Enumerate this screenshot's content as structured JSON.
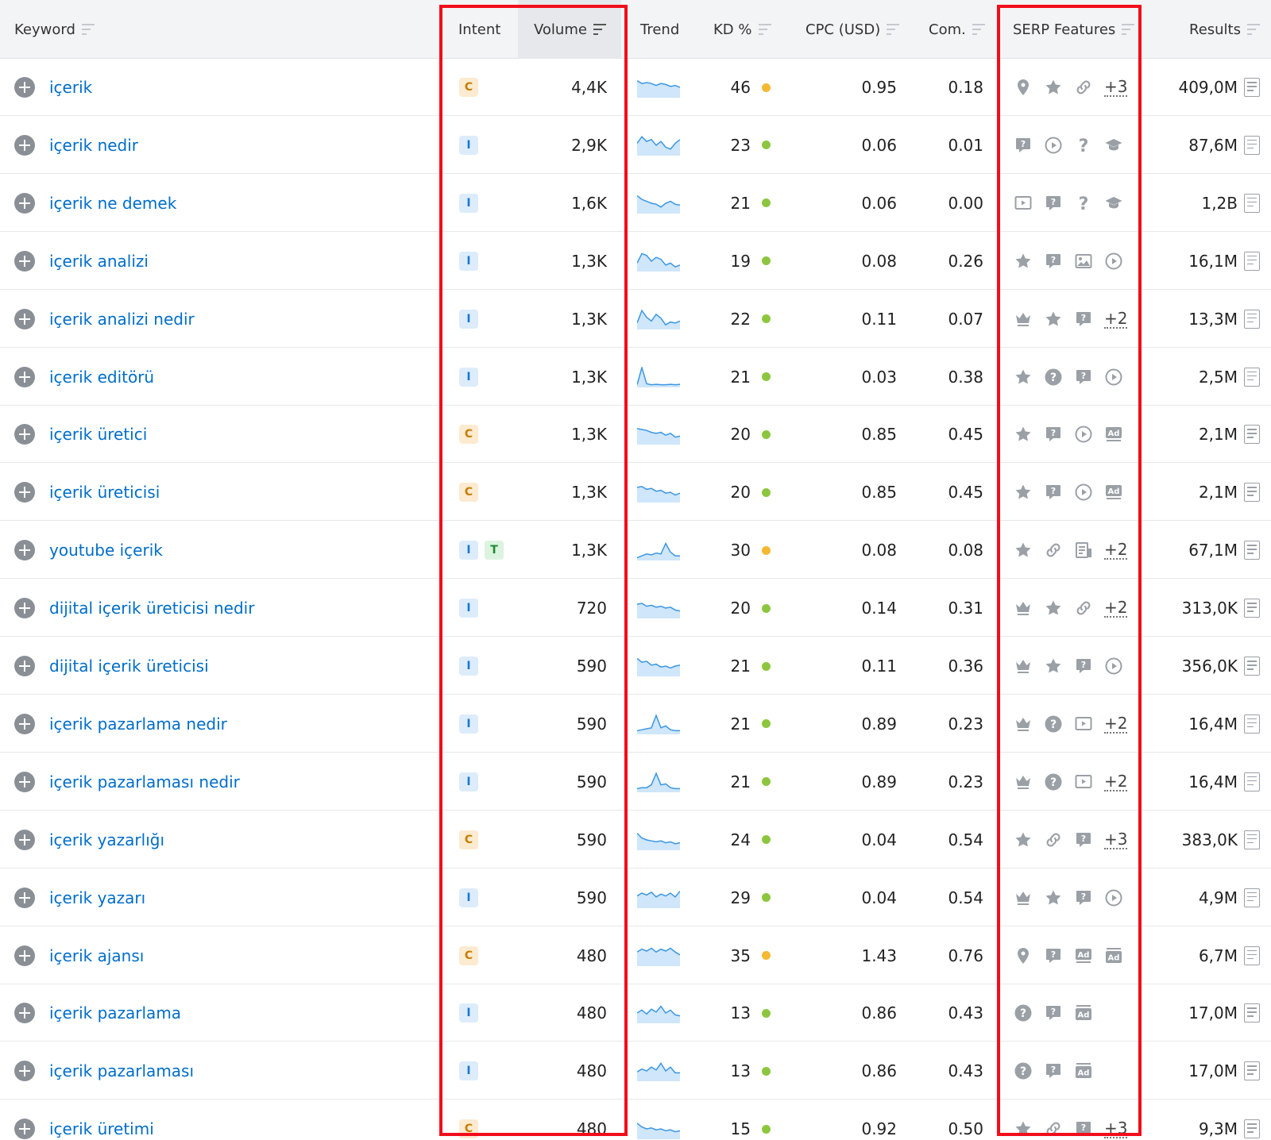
{
  "header": {
    "keyword": "Keyword",
    "intent": "Intent",
    "volume": "Volume",
    "trend": "Trend",
    "kd": "KD %",
    "cpc": "CPC (USD)",
    "com": "Com.",
    "serp": "SERP Features",
    "results": "Results"
  },
  "colors": {
    "kd_green": "#8cc63f",
    "kd_yellow": "#f5b833",
    "highlight_box": "#f20d1b",
    "keyword_link": "#006dca"
  },
  "rows": [
    {
      "keyword": "içerik",
      "intent": [
        "C"
      ],
      "volume": "4,4K",
      "trend": [
        0.85,
        0.7,
        0.75,
        0.7,
        0.6,
        0.7,
        0.65,
        0.55,
        0.6,
        0.5
      ],
      "kd": "46",
      "kd_color": "#f5b833",
      "cpc": "0.95",
      "com": "0.18",
      "serp": [
        "location-icon",
        "star-icon",
        "link-icon"
      ],
      "serp_more": "+3",
      "results": "409,0M"
    },
    {
      "keyword": "içerik nedir",
      "intent": [
        "I"
      ],
      "volume": "2,9K",
      "trend": [
        0.6,
        0.95,
        0.7,
        0.8,
        0.5,
        0.7,
        0.4,
        0.3,
        0.6,
        0.8
      ],
      "kd": "23",
      "kd_color": "#8cc63f",
      "cpc": "0.06",
      "com": "0.01",
      "serp": [
        "faq-icon",
        "video-icon",
        "question-icon",
        "academic-icon"
      ],
      "serp_more": "",
      "results": "87,6M"
    },
    {
      "keyword": "içerik ne demek",
      "intent": [
        "I"
      ],
      "volume": "1,6K",
      "trend": [
        0.9,
        0.7,
        0.6,
        0.5,
        0.45,
        0.3,
        0.5,
        0.6,
        0.45,
        0.4
      ],
      "kd": "21",
      "kd_color": "#8cc63f",
      "cpc": "0.06",
      "com": "0.00",
      "serp": [
        "video-box-icon",
        "faq-icon",
        "question-icon",
        "academic-icon"
      ],
      "serp_more": "",
      "results": "1,2B"
    },
    {
      "keyword": "içerik analizi",
      "intent": [
        "I"
      ],
      "volume": "1,3K",
      "trend": [
        0.4,
        0.9,
        0.8,
        0.5,
        0.7,
        0.6,
        0.3,
        0.4,
        0.2,
        0.3
      ],
      "kd": "19",
      "kd_color": "#8cc63f",
      "cpc": "0.08",
      "com": "0.26",
      "serp": [
        "star-icon",
        "faq-icon",
        "image-icon",
        "video-icon"
      ],
      "serp_more": "",
      "results": "16,1M"
    },
    {
      "keyword": "içerik analizi nedir",
      "intent": [
        "I"
      ],
      "volume": "1,3K",
      "trend": [
        0.3,
        0.95,
        0.6,
        0.4,
        0.75,
        0.55,
        0.2,
        0.35,
        0.3,
        0.4
      ],
      "kd": "22",
      "kd_color": "#8cc63f",
      "cpc": "0.11",
      "com": "0.07",
      "serp": [
        "crown-icon",
        "star-icon",
        "faq-icon"
      ],
      "serp_more": "+2",
      "results": "13,3M"
    },
    {
      "keyword": "içerik editörü",
      "intent": [
        "I"
      ],
      "volume": "1,3K",
      "trend": [
        0.1,
        1.0,
        0.15,
        0.1,
        0.12,
        0.1,
        0.1,
        0.12,
        0.1,
        0.12
      ],
      "kd": "21",
      "kd_color": "#8cc63f",
      "cpc": "0.03",
      "com": "0.38",
      "serp": [
        "star-icon",
        "question-circle-icon",
        "faq-icon",
        "video-icon"
      ],
      "serp_more": "",
      "results": "2,5M"
    },
    {
      "keyword": "içerik üretici",
      "intent": [
        "C"
      ],
      "volume": "1,3K",
      "trend": [
        0.8,
        0.75,
        0.7,
        0.6,
        0.55,
        0.6,
        0.45,
        0.55,
        0.35,
        0.4
      ],
      "kd": "20",
      "kd_color": "#8cc63f",
      "cpc": "0.85",
      "com": "0.45",
      "serp": [
        "star-icon",
        "faq-icon",
        "video-icon",
        "ad-icon"
      ],
      "serp_more": "",
      "results": "2,1M"
    },
    {
      "keyword": "içerik üreticisi",
      "intent": [
        "C"
      ],
      "volume": "1,3K",
      "trend": [
        0.75,
        0.8,
        0.65,
        0.7,
        0.55,
        0.6,
        0.45,
        0.5,
        0.35,
        0.45
      ],
      "kd": "20",
      "kd_color": "#8cc63f",
      "cpc": "0.85",
      "com": "0.45",
      "serp": [
        "star-icon",
        "faq-icon",
        "video-icon",
        "ad-icon"
      ],
      "serp_more": "",
      "results": "2,1M"
    },
    {
      "keyword": "youtube içerik",
      "intent": [
        "I",
        "T"
      ],
      "volume": "1,3K",
      "trend": [
        0.1,
        0.2,
        0.3,
        0.25,
        0.35,
        0.3,
        0.85,
        0.4,
        0.2,
        0.2
      ],
      "kd": "30",
      "kd_color": "#f5b833",
      "cpc": "0.08",
      "com": "0.08",
      "serp": [
        "star-icon",
        "link-icon",
        "article-icon"
      ],
      "serp_more": "+2",
      "results": "67,1M"
    },
    {
      "keyword": "dijital içerik üreticisi nedir",
      "intent": [
        "I"
      ],
      "volume": "720",
      "trend": [
        0.7,
        0.75,
        0.6,
        0.65,
        0.55,
        0.6,
        0.5,
        0.55,
        0.4,
        0.35
      ],
      "kd": "20",
      "kd_color": "#8cc63f",
      "cpc": "0.14",
      "com": "0.31",
      "serp": [
        "crown-icon",
        "star-icon",
        "link-icon"
      ],
      "serp_more": "+2",
      "results": "313,0K"
    },
    {
      "keyword": "dijital içerik üreticisi",
      "intent": [
        "I"
      ],
      "volume": "590",
      "trend": [
        0.9,
        0.7,
        0.75,
        0.55,
        0.6,
        0.45,
        0.5,
        0.4,
        0.5,
        0.55
      ],
      "kd": "21",
      "kd_color": "#8cc63f",
      "cpc": "0.11",
      "com": "0.36",
      "serp": [
        "crown-icon",
        "star-icon",
        "faq-icon",
        "video-icon"
      ],
      "serp_more": "",
      "results": "356,0K"
    },
    {
      "keyword": "içerik pazarlama nedir",
      "intent": [
        "I"
      ],
      "volume": "590",
      "trend": [
        0.15,
        0.2,
        0.25,
        0.3,
        0.95,
        0.3,
        0.4,
        0.2,
        0.15,
        0.15
      ],
      "kd": "21",
      "kd_color": "#8cc63f",
      "cpc": "0.89",
      "com": "0.23",
      "serp": [
        "crown-icon",
        "question-circle-icon",
        "video-box-icon"
      ],
      "serp_more": "+2",
      "results": "16,4M"
    },
    {
      "keyword": "içerik pazarlaması nedir",
      "intent": [
        "I"
      ],
      "volume": "590",
      "trend": [
        0.15,
        0.2,
        0.2,
        0.35,
        0.95,
        0.35,
        0.4,
        0.2,
        0.15,
        0.15
      ],
      "kd": "21",
      "kd_color": "#8cc63f",
      "cpc": "0.89",
      "com": "0.23",
      "serp": [
        "crown-icon",
        "question-circle-icon",
        "video-box-icon"
      ],
      "serp_more": "+2",
      "results": "16,4M"
    },
    {
      "keyword": "içerik yazarlığı",
      "intent": [
        "C"
      ],
      "volume": "590",
      "trend": [
        0.85,
        0.6,
        0.5,
        0.45,
        0.4,
        0.45,
        0.35,
        0.4,
        0.3,
        0.35
      ],
      "kd": "24",
      "kd_color": "#8cc63f",
      "cpc": "0.04",
      "com": "0.54",
      "serp": [
        "star-icon",
        "link-icon",
        "faq-icon"
      ],
      "serp_more": "+3",
      "results": "383,0K"
    },
    {
      "keyword": "içerik yazarı",
      "intent": [
        "I"
      ],
      "volume": "590",
      "trend": [
        0.6,
        0.75,
        0.65,
        0.8,
        0.55,
        0.7,
        0.6,
        0.75,
        0.55,
        0.85
      ],
      "kd": "29",
      "kd_color": "#8cc63f",
      "cpc": "0.04",
      "com": "0.54",
      "serp": [
        "crown-icon",
        "star-icon",
        "faq-icon",
        "video-icon"
      ],
      "serp_more": "",
      "results": "4,9M"
    },
    {
      "keyword": "içerik ajansı",
      "intent": [
        "C"
      ],
      "volume": "480",
      "trend": [
        0.7,
        0.85,
        0.75,
        0.9,
        0.7,
        0.85,
        0.75,
        0.9,
        0.7,
        0.55
      ],
      "kd": "35",
      "kd_color": "#f5b833",
      "cpc": "1.43",
      "com": "0.76",
      "serp": [
        "location-icon",
        "faq-icon",
        "ad-icon",
        "ad-stack-icon"
      ],
      "serp_more": "",
      "results": "6,7M"
    },
    {
      "keyword": "içerik pazarlama",
      "intent": [
        "I"
      ],
      "volume": "480",
      "trend": [
        0.5,
        0.65,
        0.45,
        0.7,
        0.55,
        0.85,
        0.5,
        0.65,
        0.4,
        0.35
      ],
      "kd": "13",
      "kd_color": "#8cc63f",
      "cpc": "0.86",
      "com": "0.43",
      "serp": [
        "question-circle-icon",
        "faq-icon",
        "ad-stack-icon"
      ],
      "serp_more": "",
      "results": "17,0M"
    },
    {
      "keyword": "içerik pazarlaması",
      "intent": [
        "I"
      ],
      "volume": "480",
      "trend": [
        0.45,
        0.6,
        0.5,
        0.7,
        0.55,
        0.9,
        0.5,
        0.7,
        0.4,
        0.4
      ],
      "kd": "13",
      "kd_color": "#8cc63f",
      "cpc": "0.86",
      "com": "0.43",
      "serp": [
        "question-circle-icon",
        "faq-icon",
        "ad-stack-icon"
      ],
      "serp_more": "",
      "results": "17,0M"
    },
    {
      "keyword": "içerik üretimi",
      "intent": [
        "C"
      ],
      "volume": "480",
      "trend": [
        0.8,
        0.6,
        0.5,
        0.55,
        0.45,
        0.5,
        0.4,
        0.45,
        0.35,
        0.4
      ],
      "kd": "15",
      "kd_color": "#8cc63f",
      "cpc": "0.92",
      "com": "0.50",
      "serp": [
        "star-icon",
        "link-icon",
        "faq-icon"
      ],
      "serp_more": "+3",
      "results": "9,3M"
    }
  ]
}
